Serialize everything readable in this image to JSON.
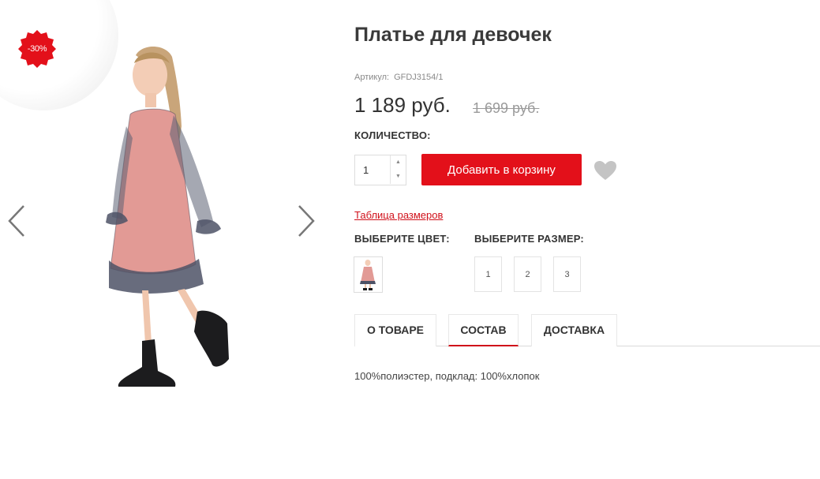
{
  "gallery": {
    "discount_badge": "-30%",
    "prev_icon": "chevron-left-icon",
    "next_icon": "chevron-right-icon",
    "badge_color": "#e3101a"
  },
  "product": {
    "title": "Платье для девочек",
    "sku_label": "Артикул:",
    "sku_value": "GFDJ3154/1",
    "price": "1 189 руб.",
    "old_price": "1 699 руб."
  },
  "quantity": {
    "label": "КОЛИЧЕСТВО:",
    "value": "1",
    "up_glyph": "▲",
    "down_glyph": "▼"
  },
  "actions": {
    "add_to_cart": "Добавить в корзину",
    "favorite_icon": "heart-icon",
    "accent_color": "#e3101a"
  },
  "size_table_link": "Таблица размеров",
  "color": {
    "label": "ВЫБЕРИТЕ ЦВЕТ:"
  },
  "size": {
    "label": "ВЫБЕРИТЕ РАЗМЕР:",
    "options": [
      "1",
      "2",
      "3"
    ]
  },
  "tabs": {
    "items": [
      "О ТОВАРЕ",
      "СОСТАВ",
      "ДОСТАВКА"
    ],
    "active": "СОСТАВ"
  },
  "composition": "100%полиэстер, подклад: 100%хлопок"
}
